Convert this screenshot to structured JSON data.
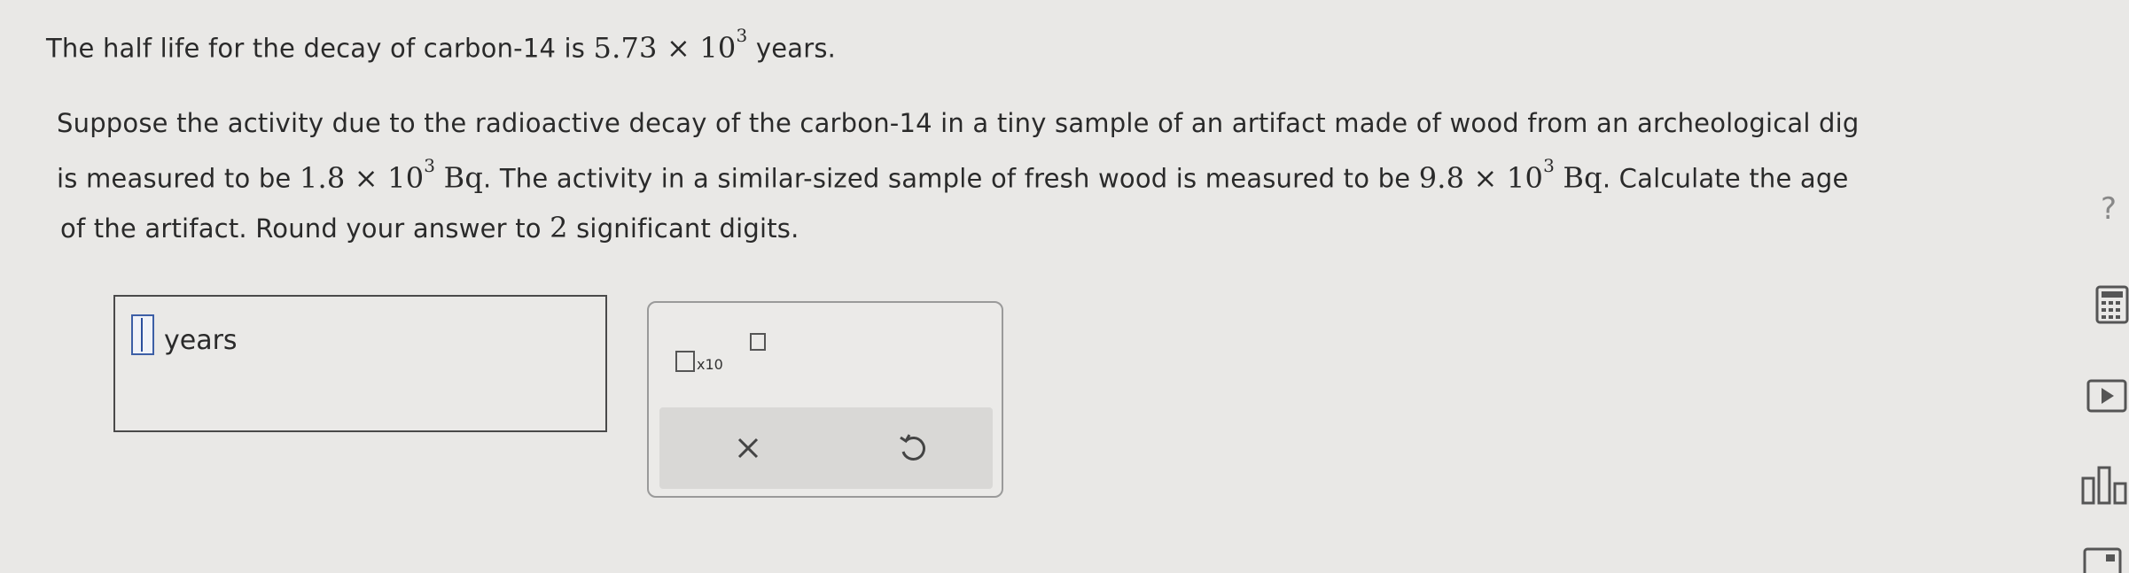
{
  "question": {
    "line1": {
      "pre": "The half life for the decay of carbon-14 is",
      "math": "5.73 × 10",
      "exp": "3",
      "post": "years."
    },
    "line2": "Suppose the activity due to the radioactive decay of the carbon-14 in a tiny sample of an artifact made of wood from an archeological dig",
    "line3": {
      "pre": "is measured to be",
      "math1": "1.8 × 10",
      "exp1": "3",
      "mid1": "Bq",
      "mid2": ". The activity in a similar-sized sample of fresh wood is measured to be",
      "math2": "9.8 × 10",
      "exp2": "3",
      "mid3": "Bq",
      "post": ". Calculate the age"
    },
    "line4": {
      "pre": "of the artifact. Round your answer to",
      "num": "2",
      "post": "significant digits."
    }
  },
  "answer": {
    "unit": "years",
    "value": ""
  },
  "tools": {
    "sci_notation_label": "x10"
  },
  "icons": {
    "sci": "scientific-notation-icon",
    "clear": "clear-x-icon",
    "undo": "undo-icon",
    "help": "help-icon",
    "calculator": "calculator-icon",
    "video": "video-play-icon",
    "chart": "bar-chart-icon",
    "table": "periodic-table-icon"
  },
  "sidebar": {
    "help_label": "?"
  }
}
